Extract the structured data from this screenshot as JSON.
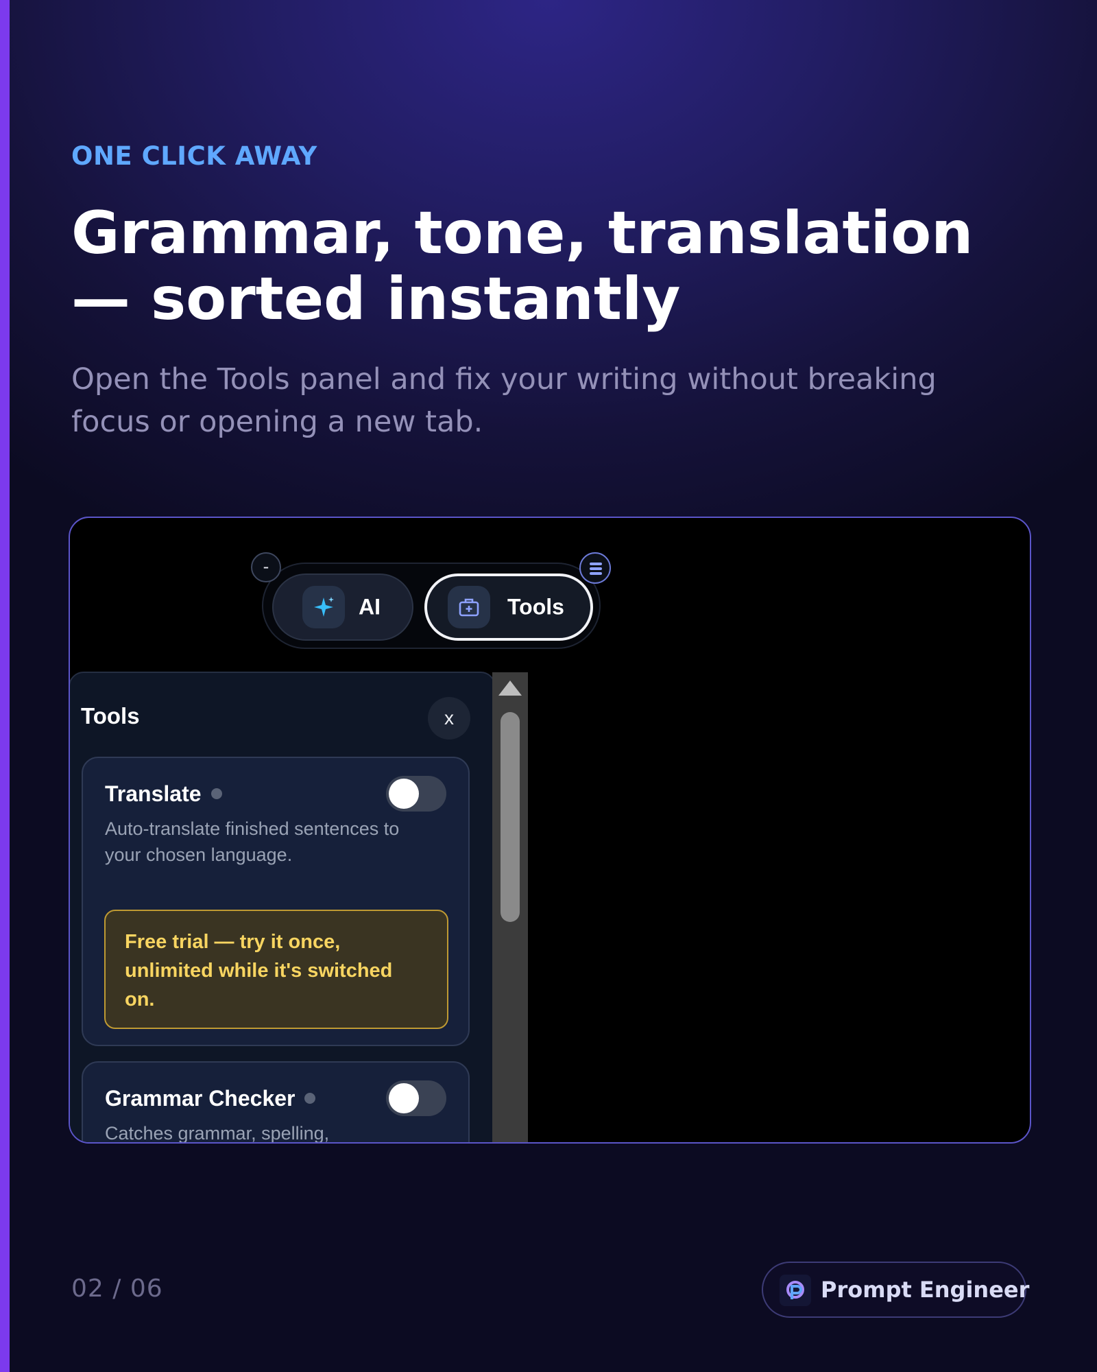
{
  "eyebrow": "ONE CLICK AWAY",
  "headline": {
    "line1": "Grammar, tone, translation",
    "line2": "— sorted instantly"
  },
  "subhead": "Open the Tools panel and fix your writing without breaking focus or opening a new tab.",
  "toolbar": {
    "minimize_label": "-",
    "ai_label": "AI",
    "tools_label": "Tools",
    "active_tab": "Tools"
  },
  "panel": {
    "title": "Tools",
    "close_label": "x",
    "cards": [
      {
        "title": "Translate",
        "description": "Auto-translate finished sentences to your chosen language.",
        "enabled": false,
        "trial_note": "Free trial — try it once, unlimited while it's switched on."
      },
      {
        "title": "Grammar Checker",
        "description": "Catches grammar, spelling,",
        "enabled": false
      }
    ]
  },
  "footer": {
    "page_counter": "02 / 06",
    "brand_name": "Prompt Engineer"
  },
  "colors": {
    "accent_bar": "#7c3aed",
    "eyebrow": "#5fa8ff",
    "frame_border": "#5b55c9",
    "trial_border": "#bf9a33",
    "trial_text": "#f8d561"
  },
  "icons": {
    "ai": "sparkle-icon",
    "tools": "toolbox-icon",
    "menu": "menu-icon",
    "brand": "brand-logo-icon"
  }
}
